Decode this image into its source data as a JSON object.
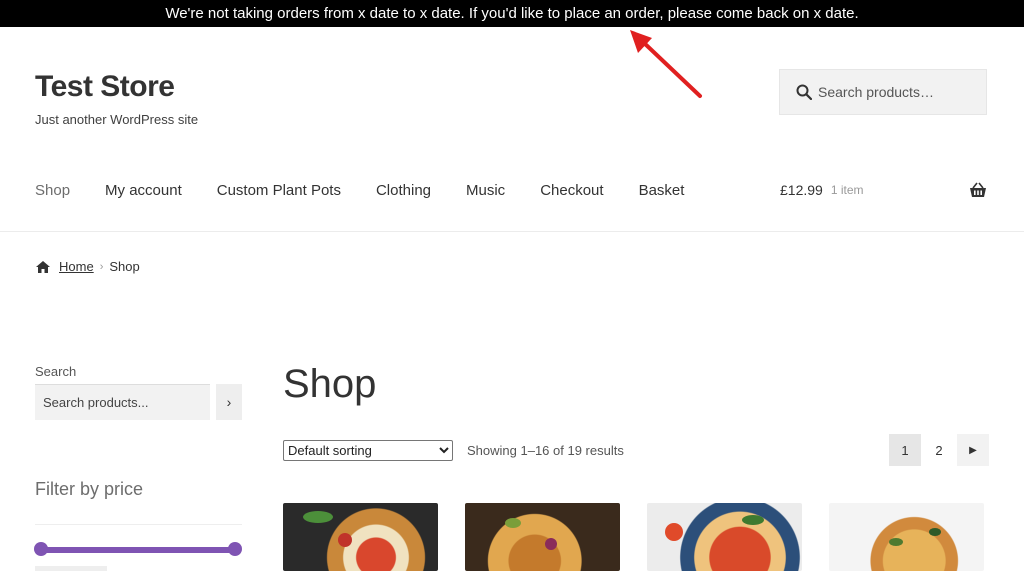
{
  "notice": {
    "text": "We're not taking orders from x date to x date. If you'd like to place an order, please come back on x date."
  },
  "site": {
    "title": "Test Store",
    "description": "Just another WordPress site"
  },
  "header_search": {
    "placeholder": "Search products…"
  },
  "nav": {
    "items": [
      {
        "label": "Shop"
      },
      {
        "label": "My account"
      },
      {
        "label": "Custom Plant Pots"
      },
      {
        "label": "Clothing"
      },
      {
        "label": "Music"
      },
      {
        "label": "Checkout"
      },
      {
        "label": "Basket"
      }
    ]
  },
  "cart": {
    "price": "£12.99",
    "count": "1 item"
  },
  "breadcrumb": {
    "home": "Home",
    "current": "Shop"
  },
  "sidebar": {
    "search_label": "Search",
    "search_placeholder": "Search products...",
    "search_button": "›",
    "filter_title": "Filter by price"
  },
  "main": {
    "page_title": "Shop",
    "sorting": {
      "selected": "Default sorting"
    },
    "result_count": "Showing 1–16 of 19 results",
    "pagination": {
      "current": "1",
      "next_page": "2",
      "next_arrow": "▶"
    }
  },
  "colors": {
    "accent": "#7f54b3",
    "notice_bg": "#000000",
    "arrow": "#e02020"
  }
}
